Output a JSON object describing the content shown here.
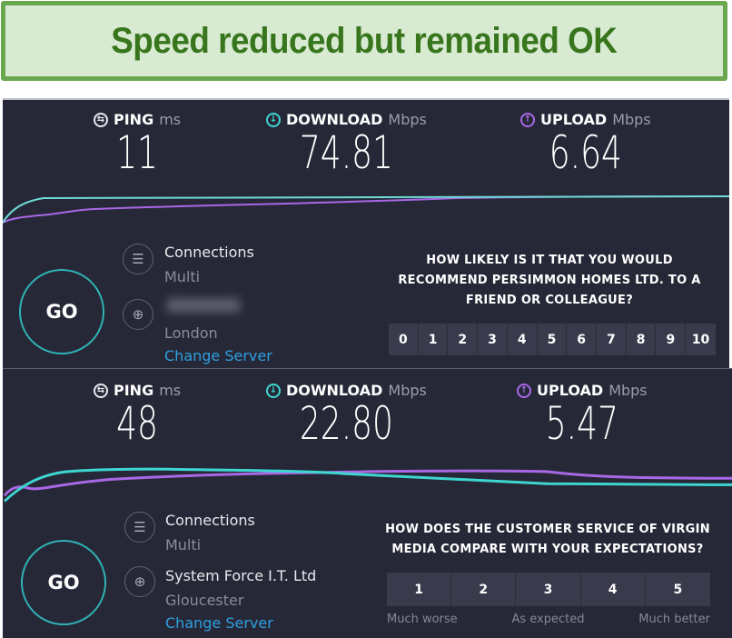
{
  "banner": {
    "title": "Speed reduced but remained OK"
  },
  "colors": {
    "download": "#3ed6d0",
    "upload": "#a868e6",
    "link": "#2e9fe0",
    "panel_bg": "#262837"
  },
  "tests": [
    {
      "ping": {
        "label": "PING",
        "unit": "ms",
        "value": "11"
      },
      "download": {
        "label": "DOWNLOAD",
        "unit": "Mbps",
        "value": "74.81"
      },
      "upload": {
        "label": "UPLOAD",
        "unit": "Mbps",
        "value": "6.64"
      },
      "go_label": "GO",
      "connections": {
        "label": "Connections",
        "value": "Multi"
      },
      "server": {
        "name": "",
        "location": "London",
        "change_label": "Change Server"
      },
      "survey": {
        "question": "HOW LIKELY IS IT THAT YOU WOULD RECOMMEND PERSIMMON HOMES LTD. TO A FRIEND OR COLLEAGUE?",
        "options": [
          "0",
          "1",
          "2",
          "3",
          "4",
          "5",
          "6",
          "7",
          "8",
          "9",
          "10"
        ],
        "scale_labels": []
      }
    },
    {
      "ping": {
        "label": "PING",
        "unit": "ms",
        "value": "48"
      },
      "download": {
        "label": "DOWNLOAD",
        "unit": "Mbps",
        "value": "22.80"
      },
      "upload": {
        "label": "UPLOAD",
        "unit": "Mbps",
        "value": "5.47"
      },
      "go_label": "GO",
      "connections": {
        "label": "Connections",
        "value": "Multi"
      },
      "server": {
        "name": "System Force I.T. Ltd",
        "location": "Gloucester",
        "change_label": "Change Server"
      },
      "survey": {
        "question": "HOW DOES THE CUSTOMER SERVICE OF VIRGIN MEDIA COMPARE WITH YOUR EXPECTATIONS?",
        "options": [
          "1",
          "2",
          "3",
          "4",
          "5"
        ],
        "scale_labels": [
          "Much worse",
          "As expected",
          "Much better"
        ]
      }
    }
  ]
}
